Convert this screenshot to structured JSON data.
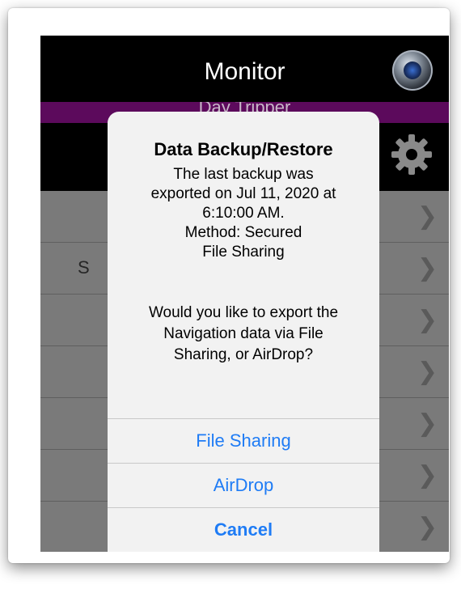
{
  "app": {
    "title": "Monitor",
    "subtitle": "Day Tripper"
  },
  "list": {
    "rows": [
      {
        "label": ""
      },
      {
        "label": "S"
      },
      {
        "label": ""
      },
      {
        "label": ""
      },
      {
        "label": ""
      },
      {
        "label": ""
      },
      {
        "label": ""
      }
    ]
  },
  "alert": {
    "title": "Data Backup/Restore",
    "message_lines": [
      "The last backup was",
      "exported on Jul 11, 2020 at",
      "6:10:00 AM.",
      "Method: Secured",
      "File Sharing"
    ],
    "question_lines": [
      "Would you like to export the",
      "Navigation data via File",
      "Sharing, or AirDrop?"
    ],
    "actions": {
      "file_sharing": "File Sharing",
      "airdrop": "AirDrop",
      "cancel": "Cancel"
    }
  },
  "icons": {
    "monitor": "monitor-icon",
    "settings": "gear-icon",
    "chevron": "chevron-right-icon"
  },
  "colors": {
    "accent": "#1f7cf5",
    "nav_bg": "#000000",
    "subtitle_bar": "#5c0a5c",
    "alert_bg": "#f2f2f2"
  }
}
